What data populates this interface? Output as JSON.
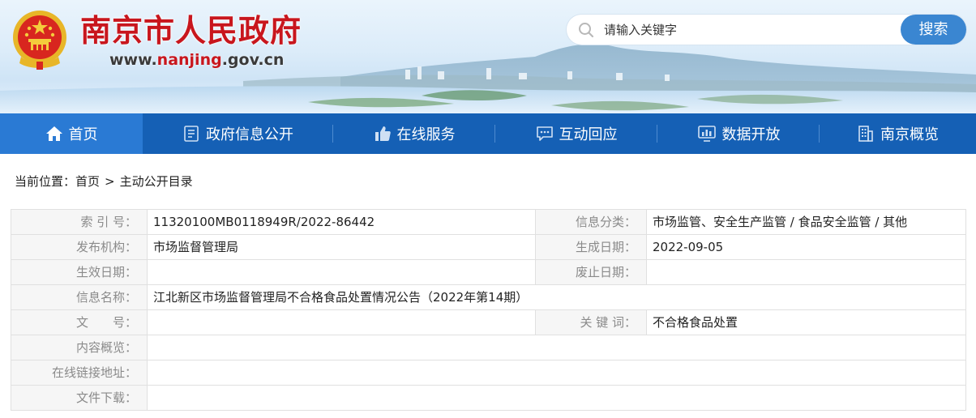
{
  "header": {
    "site_title": "南京市人民政府",
    "site_url_prefix": "www.",
    "site_url_highlight": "nanjing",
    "site_url_suffix": ".gov.cn",
    "emblem_icon": "national-emblem-icon",
    "search": {
      "placeholder": "请输入关键字",
      "button_label": "搜索",
      "icon": "search-icon"
    }
  },
  "nav": {
    "items": [
      {
        "label": "首页",
        "icon": "home-icon",
        "active": true
      },
      {
        "label": "政府信息公开",
        "icon": "document-icon",
        "active": false
      },
      {
        "label": "在线服务",
        "icon": "thumbs-up-icon",
        "active": false
      },
      {
        "label": "互动回应",
        "icon": "chat-icon",
        "active": false
      },
      {
        "label": "数据开放",
        "icon": "data-chart-icon",
        "active": false
      },
      {
        "label": "南京概览",
        "icon": "building-icon",
        "active": false
      }
    ]
  },
  "breadcrumb": {
    "prefix": "当前位置：",
    "items": [
      "首页",
      "主动公开目录"
    ],
    "separator": ">"
  },
  "info": {
    "index_label": "索 引 号：",
    "index_value": "11320100MB0118949R/2022-86442",
    "category_label": "信息分类：",
    "category_value": "市场监管、安全生产监管 / 食品安全监管 / 其他",
    "publisher_label": "发布机构：",
    "publisher_value": "市场监督管理局",
    "created_label": "生成日期：",
    "created_value": "2022-09-05",
    "effective_label": "生效日期：",
    "effective_value": "",
    "abolished_label": "废止日期：",
    "abolished_value": "",
    "name_label": "信息名称：",
    "name_value": "江北新区市场监督管理局不合格食品处置情况公告（2022年第14期）",
    "doc_number_label": "文　　号：",
    "doc_number_value": "",
    "keywords_label": "关 键 词：",
    "keywords_value": "不合格食品处置",
    "summary_label": "内容概览：",
    "summary_value": "",
    "online_link_label": "在线链接地址：",
    "online_link_value": "",
    "download_label": "文件下载：",
    "download_value": ""
  },
  "colors": {
    "brand_red": "#c8161d",
    "nav_blue": "#1560b5",
    "nav_active": "#2a7ad4",
    "search_button": "#3a86d1"
  }
}
